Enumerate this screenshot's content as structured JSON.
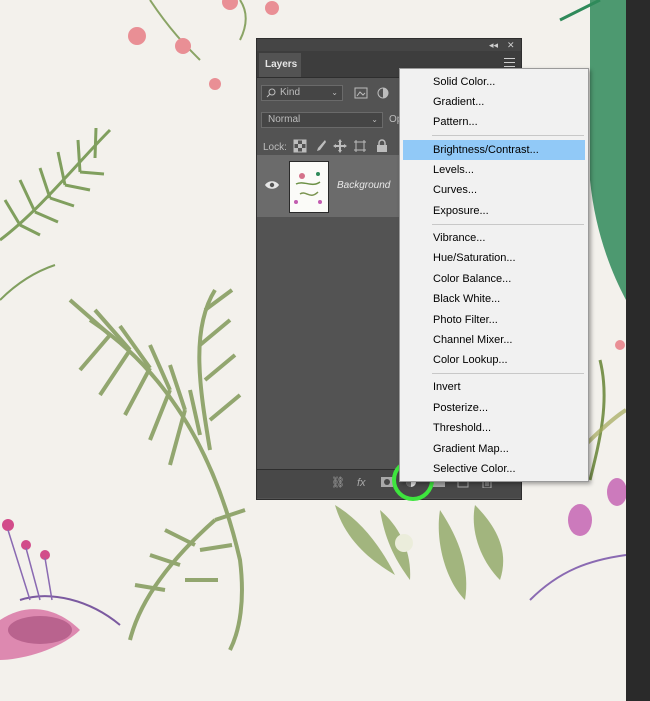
{
  "panel": {
    "tab_label": "Layers",
    "kind_label": "Kind",
    "blend_mode": "Normal",
    "opacity_label": "Op",
    "lock_label": "Lock:",
    "layer": {
      "name": "Background"
    }
  },
  "menu": {
    "items": [
      "Solid Color...",
      "Gradient...",
      "Pattern...",
      "Brightness/Contrast...",
      "Levels...",
      "Curves...",
      "Exposure...",
      "Vibrance...",
      "Hue/Saturation...",
      "Color Balance...",
      "Black  White...",
      "Photo Filter...",
      "Channel Mixer...",
      "Color Lookup...",
      "Invert",
      "Posterize...",
      "Threshold...",
      "Gradient Map...",
      "Selective Color..."
    ],
    "active_index": 3,
    "highlight_color": "#91c9f7"
  },
  "icons": {
    "footer": [
      "link-icon",
      "fx-icon",
      "mask-icon",
      "adjustment-icon",
      "group-icon",
      "new-layer-icon",
      "trash-icon"
    ]
  },
  "colors": {
    "panel_bg": "#535353",
    "selected_layer_bg": "#6b6b6b",
    "callout_ring": "#3ee53e"
  }
}
